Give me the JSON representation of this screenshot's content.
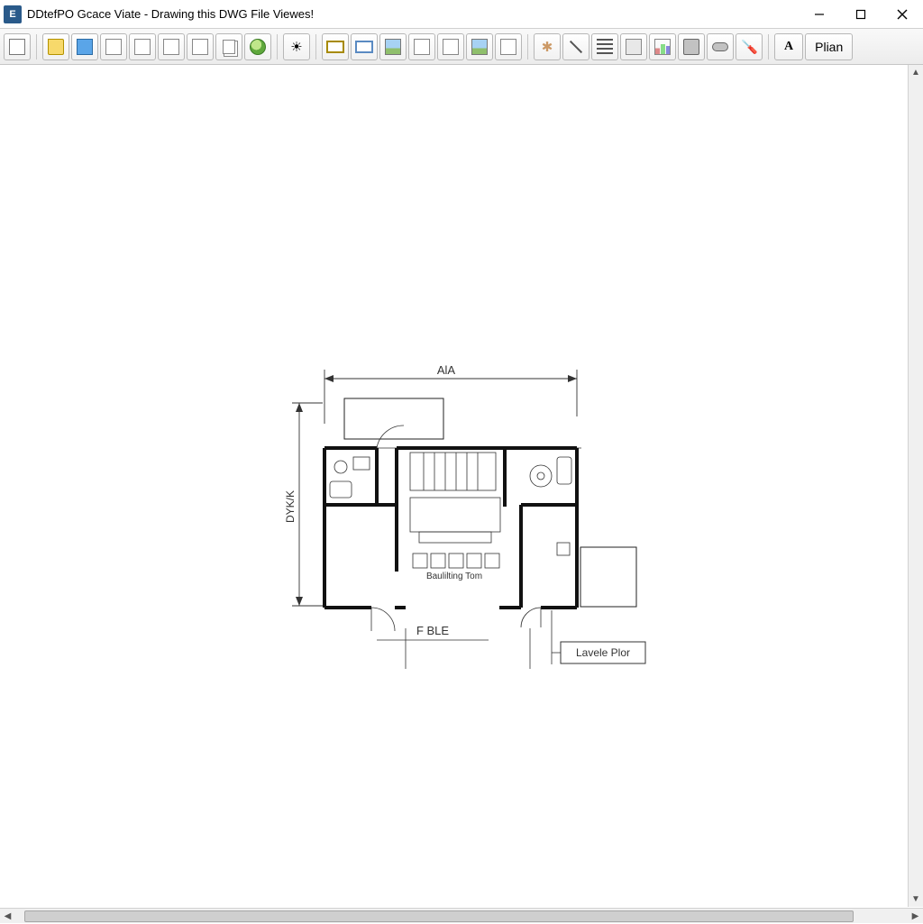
{
  "window": {
    "title": "DDtefPO Gcace Viate - Drawing this DWG File Viewes!",
    "appIconLetter": "E"
  },
  "toolbar": {
    "textButton": "A",
    "planButton": "Plian",
    "icons": [
      "new-file-icon",
      "open-file-icon",
      "save-icon",
      "page-setup-icon",
      "print-preview-icon",
      "page-icon-1",
      "page-icon-2",
      "pages-icon",
      "globe-icon",
      "sun-icon",
      "rect-frame-icon",
      "window-icon",
      "image-icon",
      "eye-icon",
      "colorwheel-icon",
      "layers-icon",
      "export-icon",
      "star-icon",
      "line-icon",
      "list-icon",
      "folder-icon",
      "chart-icon",
      "camera-icon",
      "tape-icon",
      "measure-icon"
    ]
  },
  "drawing": {
    "dimTop": "AlA",
    "dimLeft": "DYK/K",
    "roomLabel": "Baulilting Tom",
    "bottomLabel": "F BLE",
    "tagLabel": "Lavele Plor"
  }
}
